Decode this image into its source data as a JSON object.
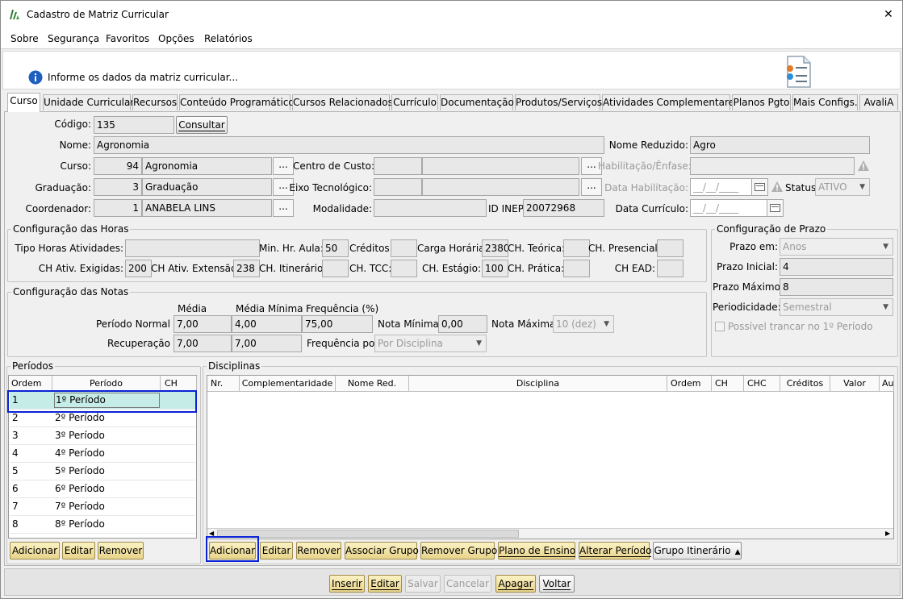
{
  "window": {
    "title": "Cadastro de Matriz Curricular",
    "close": "✕"
  },
  "menu": [
    "Sobre",
    "Segurança",
    "Favoritos",
    "Opções",
    "Relatórios"
  ],
  "info": {
    "text": "Informe os dados da matriz curricular..."
  },
  "tabs": [
    "Curso",
    "Unidade Curricular",
    "Recursos",
    "Conteúdo Programático",
    "Cursos Relacionados",
    "Currículo",
    "Documentação",
    "Produtos/Serviços",
    "Atividades Complementares",
    "Planos Pgto",
    "Mais Configs.",
    "AvaliA"
  ],
  "form": {
    "codigo_label": "Código:",
    "codigo": "135",
    "consultar": "Consultar",
    "nome_label": "Nome:",
    "nome": "Agronomia",
    "nome_reduzido_label": "Nome Reduzido:",
    "nome_reduzido": "Agro",
    "curso_label": "Curso:",
    "curso_id": "94",
    "curso_nome": "Agronomia",
    "centro_custo_label": "Centro de Custo:",
    "habilitacao_label": "Habilitação/Ênfase:",
    "graduacao_label": "Graduação:",
    "graduacao_id": "3",
    "graduacao_nome": "Graduação",
    "eixo_label": "Eixo Tecnológico:",
    "data_habilitacao_label": "Data Habilitação:",
    "data_habilitacao": "__/__/____",
    "status_label": "Status:",
    "status": "ATIVO",
    "coordenador_label": "Coordenador:",
    "coordenador_id": "1",
    "coordenador_nome": "ANABELA LINS",
    "modalidade_label": "Modalidade:",
    "id_inep_label": "ID INEP:",
    "id_inep": "20072968",
    "data_curriculo_label": "Data Currículo:",
    "data_curriculo": "__/__/____",
    "dots": "..."
  },
  "horas": {
    "title": "Configuração das Horas",
    "tipo_horas_label": "Tipo Horas Atividades:",
    "min_hr_aula_label": "Min. Hr. Aula:",
    "min_hr_aula": "50",
    "creditos_label": "Créditos:",
    "carga_horaria_label": "Carga Horária:",
    "carga_horaria": "2380",
    "ch_teorica_label": "CH. Teórica:",
    "ch_presencial_label": "CH. Presencial:",
    "ch_ativ_exigidas_label": "CH Ativ. Exigidas:",
    "ch_ativ_exigidas": "200",
    "ch_ativ_extensao_label": "CH Ativ. Extensão:",
    "ch_ativ_extensao": "238",
    "ch_itinerario_label": "CH. Itinerário:",
    "ch_tcc_label": "CH. TCC:",
    "ch_estagio_label": "CH. Estágio:",
    "ch_estagio": "100",
    "ch_pratica_label": "CH. Prática:",
    "ch_ead_label": "CH EAD:"
  },
  "prazo": {
    "title": "Configuração de Prazo",
    "prazo_em_label": "Prazo em:",
    "prazo_em": "Anos",
    "prazo_inicial_label": "Prazo Inicial:",
    "prazo_inicial": "4",
    "prazo_maximo_label": "Prazo Máximo:",
    "prazo_maximo": "8",
    "periodicidade_label": "Periodicidade:",
    "periodicidade": "Semestral",
    "trancar_label": "Possível trancar no 1º Período"
  },
  "notas": {
    "title": "Configuração das Notas",
    "media_label": "Média",
    "media_minima_label": "Média Mínima",
    "frequencia_label": "Frequência (%)",
    "periodo_normal_label": "Período Normal",
    "pn_media": "7,00",
    "pn_media_minima": "4,00",
    "pn_frequencia": "75,00",
    "nota_minima_label": "Nota Mínima",
    "nota_minima": "0,00",
    "nota_maxima_label": "Nota Máxima",
    "nota_maxima": "10 (dez)",
    "recuperacao_label": "Recuperação",
    "rec_media": "7,00",
    "rec_media_minima": "7,00",
    "frequencia_por_label": "Frequência por:",
    "frequencia_por": "Por Disciplina"
  },
  "periodos": {
    "title": "Períodos",
    "columns": [
      "Ordem",
      "Período",
      "CH"
    ],
    "rows": [
      {
        "ordem": "1",
        "periodo": "1º Período",
        "ch": ""
      },
      {
        "ordem": "2",
        "periodo": "2º Período",
        "ch": ""
      },
      {
        "ordem": "3",
        "periodo": "3º Período",
        "ch": ""
      },
      {
        "ordem": "4",
        "periodo": "4º Período",
        "ch": ""
      },
      {
        "ordem": "5",
        "periodo": "5º Período",
        "ch": ""
      },
      {
        "ordem": "6",
        "periodo": "6º Período",
        "ch": ""
      },
      {
        "ordem": "7",
        "periodo": "7º Período",
        "ch": ""
      },
      {
        "ordem": "8",
        "periodo": "8º Período",
        "ch": ""
      }
    ],
    "buttons": [
      "Adicionar",
      "Editar",
      "Remover"
    ]
  },
  "disciplinas": {
    "title": "Disciplinas",
    "columns": [
      "Nr.",
      "Complementaridade",
      "Nome Red.",
      "Disciplina",
      "Ordem",
      "CH",
      "CHC",
      "Créditos",
      "Valor",
      "Au"
    ],
    "buttons": [
      "Adicionar",
      "Editar",
      "Remover",
      "Associar Grupo",
      "Remover Grupo",
      "Plano de Ensino",
      "Alterar Período",
      "Grupo Itinerário"
    ]
  },
  "footer": {
    "buttons": [
      "Inserir",
      "Editar",
      "Salvar",
      "Cancelar",
      "Apagar",
      "Voltar"
    ]
  }
}
